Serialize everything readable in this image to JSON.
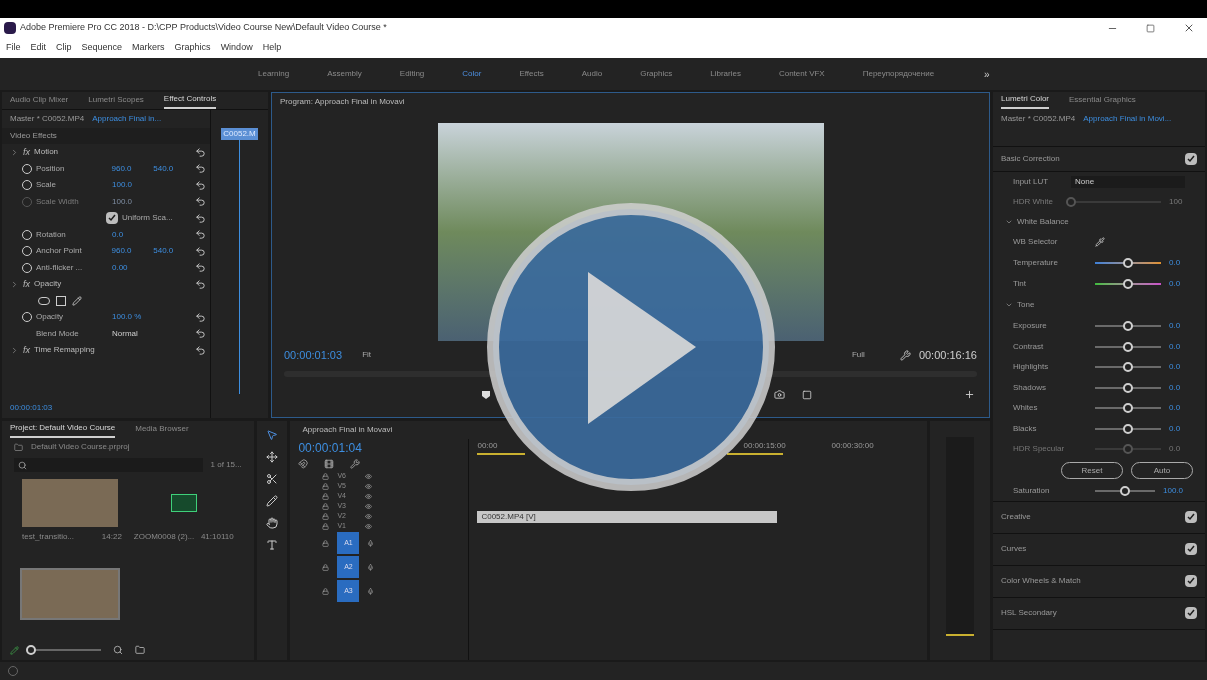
{
  "window": {
    "title": "Adobe Premiere Pro CC 2018 - D:\\CPP Products\\Video Course New\\Default Video Course *"
  },
  "menu": [
    "File",
    "Edit",
    "Clip",
    "Sequence",
    "Markers",
    "Graphics",
    "Window",
    "Help"
  ],
  "workspaces": [
    {
      "label": "Learning",
      "selected": false
    },
    {
      "label": "Assembly",
      "selected": false
    },
    {
      "label": "Editing",
      "selected": false
    },
    {
      "label": "Color",
      "selected": true
    },
    {
      "label": "Effects",
      "selected": false
    },
    {
      "label": "Audio",
      "selected": false
    },
    {
      "label": "Graphics",
      "selected": false
    },
    {
      "label": "Libraries",
      "selected": false
    },
    {
      "label": "Content VFX",
      "selected": false
    },
    {
      "label": "Переупорядочение",
      "selected": false
    }
  ],
  "workspaces_more": "»",
  "effect_panel": {
    "tabs": [
      {
        "label": "Audio Clip Mixer",
        "selected": false
      },
      {
        "label": "Lumetri Scopes",
        "selected": false
      },
      {
        "label": "Effect Controls",
        "selected": true
      }
    ],
    "master": "Master * C0052.MP4",
    "sequence": "Approach Final in...",
    "clip_tag": "C0052.M",
    "section": "Video Effects",
    "rows": [
      {
        "kind": "group",
        "fx": "fx",
        "label": "Motion"
      },
      {
        "kind": "param",
        "label": "Position",
        "values": [
          "960.0",
          "540.0"
        ]
      },
      {
        "kind": "param",
        "label": "Scale",
        "values": [
          "100.0"
        ]
      },
      {
        "kind": "param",
        "label": "Scale Width",
        "values": [
          "100.0"
        ],
        "disabled": true
      },
      {
        "kind": "check",
        "label": "Uniform Sca...",
        "checked": true
      },
      {
        "kind": "param",
        "label": "Rotation",
        "values": [
          "0.0"
        ]
      },
      {
        "kind": "param",
        "label": "Anchor Point",
        "values": [
          "960.0",
          "540.0"
        ]
      },
      {
        "kind": "param",
        "label": "Anti-flicker ...",
        "values": [
          "0.00"
        ]
      },
      {
        "kind": "group",
        "fx": "fx",
        "label": "Opacity"
      },
      {
        "kind": "masks"
      },
      {
        "kind": "param",
        "label": "Opacity",
        "values": [
          "100.0 %"
        ]
      },
      {
        "kind": "select",
        "label": "Blend Mode",
        "values": [
          "Normal"
        ]
      },
      {
        "kind": "group",
        "fx": "fx",
        "label": "Time Remapping"
      }
    ],
    "timecode": "00:00:01:03"
  },
  "program": {
    "title": "Program: Approach Final in Movavi",
    "timecode": "00:00:01:03",
    "fit": "Fit",
    "quality": "Full",
    "duration": "00:00:16:16"
  },
  "project": {
    "tabs": [
      {
        "label": "Project: Default Video Course",
        "selected": true
      },
      {
        "label": "Media Browser",
        "selected": false
      }
    ],
    "file": "Default Video Course.prproj",
    "count": "1 of 15...",
    "zoom": {
      "level": 0.0
    },
    "items": [
      {
        "kind": "video",
        "name": "test_transitio...",
        "duration": "14:22"
      },
      {
        "kind": "audio",
        "name": "ZOOM0008 (2)...",
        "duration": "41:10110"
      },
      {
        "kind": "video",
        "selected": true
      }
    ]
  },
  "timeline": {
    "title": "Approach Final in Movavi",
    "timecode": "00:00:01:04",
    "ruler": [
      "00:00",
      "00:00:15:00",
      "00:00:30:00"
    ],
    "video_tracks": [
      "V6",
      "V5",
      "V4",
      "V3",
      "V2",
      "V1"
    ],
    "audio_tracks": [
      "A1",
      "A2",
      "A3"
    ],
    "clip": "C0052.MP4 [V]"
  },
  "lumetri": {
    "tabs": [
      {
        "label": "Lumetri Color",
        "selected": true
      },
      {
        "label": "Essential Graphics",
        "selected": false
      }
    ],
    "master": "Master * C0052.MP4",
    "sequence": "Approach Final in Movi...",
    "basic": {
      "label": "Basic Correction",
      "checked": true
    },
    "input_lut": {
      "label": "Input LUT",
      "value": "None"
    },
    "hdr_white": {
      "label": "HDR White",
      "value": "100",
      "level": 0.0
    },
    "white_balance": "White Balance",
    "wb_selector": "WB Selector",
    "wb_sliders": [
      {
        "label": "Temperature",
        "value": "0.0",
        "level": 0.5,
        "kind": "temperature"
      },
      {
        "label": "Tint",
        "value": "0.0",
        "level": 0.5,
        "kind": "tint"
      }
    ],
    "tone": "Tone",
    "tone_sliders": [
      {
        "label": "Exposure",
        "value": "0.0",
        "level": 0.5,
        "disabled": false
      },
      {
        "label": "Contrast",
        "value": "0.0",
        "level": 0.5,
        "disabled": false
      },
      {
        "label": "Highlights",
        "value": "0.0",
        "level": 0.5,
        "disabled": false
      },
      {
        "label": "Shadows",
        "value": "0.0",
        "level": 0.5,
        "disabled": false
      },
      {
        "label": "Whites",
        "value": "0.0",
        "level": 0.5,
        "disabled": false
      },
      {
        "label": "Blacks",
        "value": "0.0",
        "level": 0.5,
        "disabled": false
      },
      {
        "label": "HDR Specular",
        "value": "0.0",
        "level": 0.5,
        "disabled": true
      }
    ],
    "buttons": [
      "Reset",
      "Auto"
    ],
    "saturation": {
      "label": "Saturation",
      "value": "100.0",
      "level": 0.5
    },
    "sections": [
      {
        "label": "Creative",
        "checked": true
      },
      {
        "label": "Curves",
        "checked": true
      },
      {
        "label": "Color Wheels & Match",
        "checked": true
      },
      {
        "label": "HSL Secondary",
        "checked": true
      }
    ]
  }
}
